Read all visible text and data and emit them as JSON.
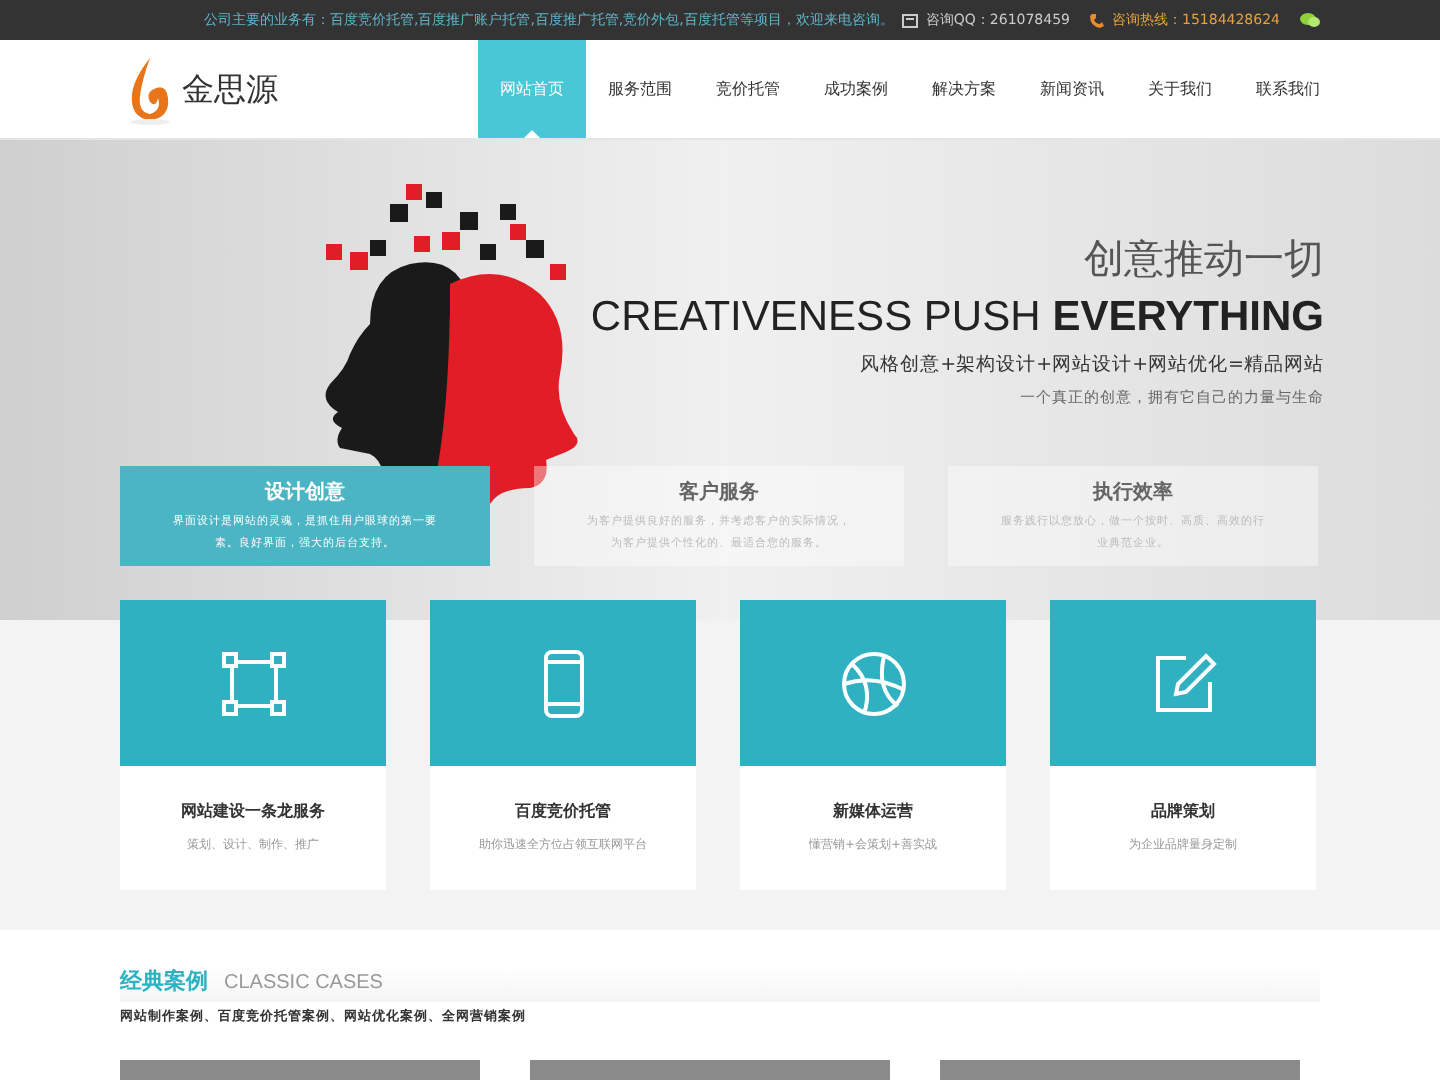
{
  "top_bar": {
    "notice": "公司主要的业务有：百度竞价托管,百度推广账户托管,百度推广托管,竞价外包,百度托管等项目，欢迎来电咨询。",
    "qq": "咨询QQ：261078459",
    "hotline": "咨询热线：15184428624"
  },
  "logo": {
    "text": "金思源"
  },
  "nav": [
    {
      "label": "网站首页",
      "selected": true
    },
    {
      "label": "服务范围",
      "selected": false
    },
    {
      "label": "竞价托管",
      "selected": false
    },
    {
      "label": "成功案例",
      "selected": false
    },
    {
      "label": "解决方案",
      "selected": false
    },
    {
      "label": "新闻资讯",
      "selected": false
    },
    {
      "label": "关于我们",
      "selected": false
    },
    {
      "label": "联系我们",
      "selected": false
    }
  ],
  "hero": {
    "heading": "创意推动一切",
    "slogan_light": "CREATIVENESS PUSH",
    "slogan_bold": "EVERYTHING",
    "formula": "风格创意+架构设计+网站设计+网站优化=精品网站",
    "tagline": "一个真正的创意，拥有它自己的力量与生命"
  },
  "features": [
    {
      "title": "设计创意",
      "text": "界面设计是网站的灵魂，是抓住用户眼球的第一要素。良好界面，强大的后台支持。",
      "selected": true
    },
    {
      "title": "客户服务",
      "text": "为客户提供良好的服务，并考虑客户的实际情况，为客户提供个性化的、最适合您的服务。",
      "selected": false
    },
    {
      "title": "执行效率",
      "text": "服务践行以您放心，做一个按时、高质、高效的行业典范企业。",
      "selected": false
    }
  ],
  "services": [
    {
      "kind": "frame",
      "title": "网站建设一条龙服务",
      "text": "策划、设计、制作、推广"
    },
    {
      "kind": "phone",
      "title": "百度竞价托管",
      "text": "助你迅速全方位占领互联网平台"
    },
    {
      "kind": "ball",
      "title": "新媒体运营",
      "text": "懂营销+会策划+善实战"
    },
    {
      "kind": "edit",
      "title": "品牌策划",
      "text": "为企业品牌量身定制"
    }
  ],
  "cases": {
    "title": "经典案例",
    "subtitle": "CLASSIC CASES",
    "links": "网站制作案例、百度竞价托管案例、网站优化案例、全网营销案例",
    "thumbnails": [
      {
        "kind": "screenshot"
      },
      {
        "kind": "screenshot"
      },
      {
        "kind": "screenshot"
      }
    ]
  }
}
